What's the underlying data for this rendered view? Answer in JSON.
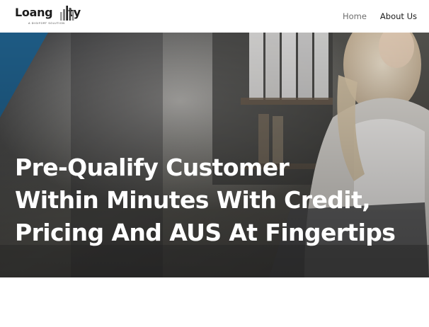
{
  "brand": {
    "name_prefix": "Loang",
    "name_suffix": "ty",
    "tagline": "A DIGIFORT SOLUTION"
  },
  "nav": {
    "items": [
      {
        "label": "Home"
      },
      {
        "label": "About Us"
      }
    ]
  },
  "hero": {
    "headline_lines": [
      "Pre-Qualify Customer",
      "Within Minutes With Credit,",
      "Pricing And AUS At Fingertips"
    ]
  },
  "colors": {
    "accent": "#1f5f8a",
    "text_dark": "#1a1a1a",
    "hero_text": "#ffffff"
  }
}
